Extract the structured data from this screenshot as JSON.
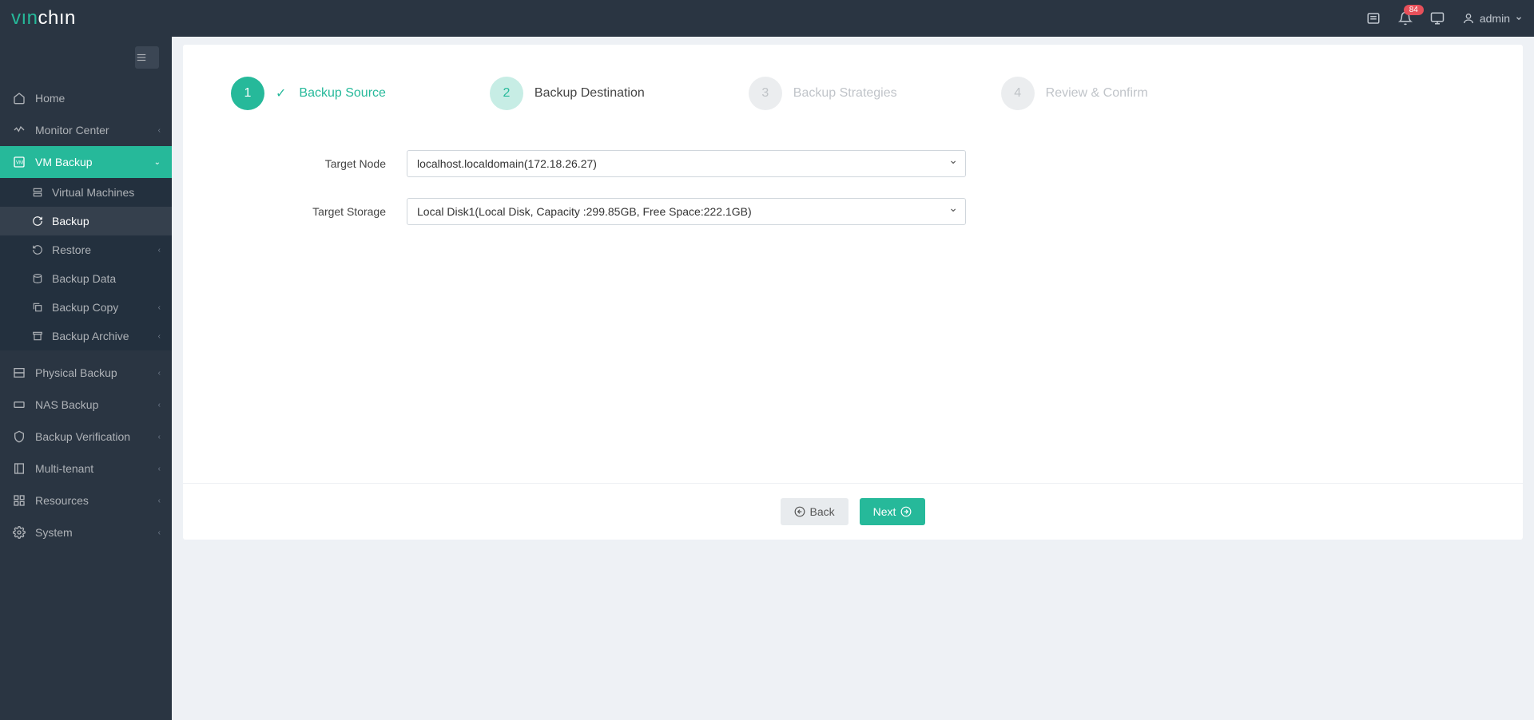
{
  "brand": {
    "part1": "vın",
    "part2": "chın"
  },
  "header": {
    "notification_count": "84",
    "user": "admin"
  },
  "sidebar": {
    "items": [
      {
        "label": "Home",
        "icon": "home"
      },
      {
        "label": "Monitor Center",
        "icon": "monitor",
        "arrow": true
      },
      {
        "label": "VM Backup",
        "icon": "vm",
        "arrow": true,
        "active": true
      },
      {
        "label": "Physical Backup",
        "icon": "physical",
        "arrow": true
      },
      {
        "label": "NAS Backup",
        "icon": "nas",
        "arrow": true
      },
      {
        "label": "Backup Verification",
        "icon": "verify",
        "arrow": true
      },
      {
        "label": "Multi-tenant",
        "icon": "tenant",
        "arrow": true
      },
      {
        "label": "Resources",
        "icon": "resources",
        "arrow": true
      },
      {
        "label": "System",
        "icon": "system",
        "arrow": true
      }
    ],
    "vm_sub": [
      {
        "label": "Virtual Machines"
      },
      {
        "label": "Backup",
        "selected": true
      },
      {
        "label": "Restore",
        "arrow": true
      },
      {
        "label": "Backup Data"
      },
      {
        "label": "Backup Copy",
        "arrow": true
      },
      {
        "label": "Backup Archive",
        "arrow": true
      }
    ]
  },
  "wizard": {
    "steps": [
      {
        "num": "1",
        "label": "Backup Source"
      },
      {
        "num": "2",
        "label": "Backup Destination"
      },
      {
        "num": "3",
        "label": "Backup Strategies"
      },
      {
        "num": "4",
        "label": "Review & Confirm"
      }
    ]
  },
  "form": {
    "target_node_label": "Target Node",
    "target_node_value": "localhost.localdomain(172.18.26.27)",
    "target_storage_label": "Target Storage",
    "target_storage_value": "Local Disk1(Local Disk, Capacity :299.85GB, Free Space:222.1GB)"
  },
  "buttons": {
    "back": "Back",
    "next": "Next"
  }
}
